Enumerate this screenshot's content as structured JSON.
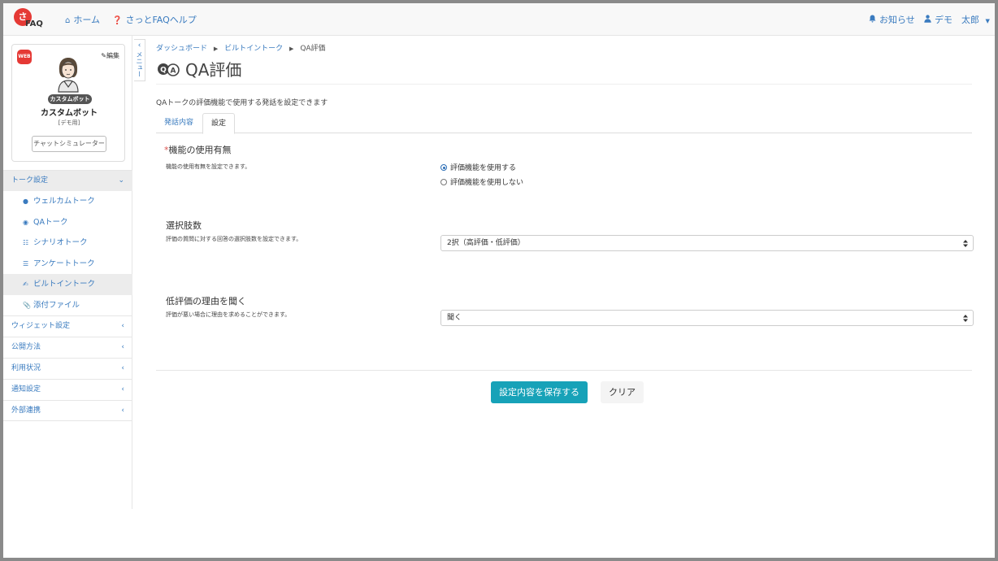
{
  "app": {
    "logo_text": "FAQ",
    "logo_mark": "さ"
  },
  "topbar": {
    "home": "ホーム",
    "help": "さっとFAQヘルプ",
    "notifications": "お知らせ",
    "user": "デモ　太郎"
  },
  "bot": {
    "badge": "WEB",
    "edit": "編集",
    "pill": "カスタムボット",
    "name": "カスタムボット",
    "sub": "[デモ用]",
    "simulator": "チャットシミュレーター"
  },
  "sidebar": {
    "talk_settings": "トーク設定",
    "items": [
      {
        "label": "ウェルカムトーク",
        "icon": "welcome-icon"
      },
      {
        "label": "QAトーク",
        "icon": "qa-icon"
      },
      {
        "label": "シナリオトーク",
        "icon": "sitemap-icon"
      },
      {
        "label": "アンケートトーク",
        "icon": "list-icon"
      },
      {
        "label": "ビルトイントーク",
        "icon": "comments-icon"
      },
      {
        "label": "添付ファイル",
        "icon": "paperclip-icon"
      }
    ],
    "groups": [
      "ウィジェット設定",
      "公開方法",
      "利用状況",
      "通知設定",
      "外部連携"
    ]
  },
  "collapse": {
    "label": "メニュー"
  },
  "breadcrumb": {
    "dashboard": "ダッシュボード",
    "builtin": "ビルトイントーク",
    "current": "QA評価"
  },
  "page": {
    "title": "QA評価",
    "description": "QAトークの評価機能で使用する発話を設定できます"
  },
  "tabs": {
    "speech": "発話内容",
    "settings": "設定"
  },
  "form": {
    "feature": {
      "required_mark": "*",
      "title": "機能の使用有無",
      "desc": "機能の使用有無を設定できます。",
      "option_on": "評価機能を使用する",
      "option_off": "評価機能を使用しない"
    },
    "choices": {
      "title": "選択肢数",
      "desc": "評価の質問に対する回答の選択肢数を設定できます。",
      "value": "2択（高評価・低評価）"
    },
    "reason": {
      "title": "低評価の理由を聞く",
      "desc": "評価が悪い場合に理由を求めることができます。",
      "value": "聞く"
    }
  },
  "buttons": {
    "save": "設定内容を保存する",
    "clear": "クリア"
  },
  "colors": {
    "link": "#3a7bbf",
    "primary": "#17a2b8",
    "brand": "#e53935"
  }
}
